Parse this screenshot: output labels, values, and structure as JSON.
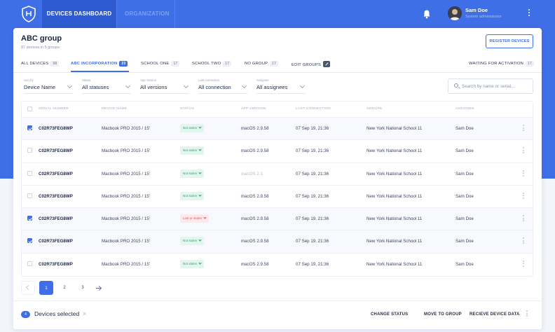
{
  "nav": {
    "items": [
      "DEVICES DASHBOARD",
      "ORGANIZATION"
    ]
  },
  "user": {
    "name": "Sam Doe",
    "role": "System administrator"
  },
  "group": {
    "title": "ABC group",
    "subtitle": "87 devices in 5 groups",
    "register_label": "REGISTER DEVICES"
  },
  "tabs": [
    {
      "label": "ALL DEVICES",
      "count": "98"
    },
    {
      "label": "ABC INCORPORATION",
      "count": "23"
    },
    {
      "label": "SCHOOL ONE",
      "count": "17"
    },
    {
      "label": "SCHOOL TWO",
      "count": "17"
    },
    {
      "label": "NO GROUP",
      "count": "17"
    },
    {
      "label": "EDIT GROUPS",
      "count": ""
    },
    {
      "label": "WAITING FOR ACTIVATION",
      "count": "17"
    }
  ],
  "filters": [
    {
      "label": "Sort by",
      "value": "Device Name"
    },
    {
      "label": "Status",
      "value": "All statuses"
    },
    {
      "label": "App Version",
      "value": "All versions"
    },
    {
      "label": "Last connection",
      "value": "All connection"
    },
    {
      "label": "Assignee",
      "value": "All assignees"
    }
  ],
  "search": {
    "placeholder": "Search by name or serial..."
  },
  "table": {
    "headers": [
      "SERIAL NUMBER",
      "DEVICE NAME",
      "STATUS",
      "APP VERSION",
      "LAST CONNECTION",
      "GROUPE",
      "ASSIGNEE"
    ],
    "rows": [
      {
        "checked": true,
        "serial": "C02R73FEG8WP",
        "device": "Macbook PRO 2015 / 15'",
        "status": "Not stolen",
        "status_kind": "ok",
        "app": "macOS 2.9.58",
        "app_dim": false,
        "last": "07 Sep 19, 21:36",
        "group": "New York National School 11",
        "assignee": "Sam Doe"
      },
      {
        "checked": false,
        "serial": "C02R73FEG8WP",
        "device": "Macbook PRO 2015 / 15'",
        "status": "Not stolen",
        "status_kind": "ok",
        "app": "macOS 2.9.58",
        "app_dim": false,
        "last": "07 Sep 19, 21:36",
        "group": "New York National School 11",
        "assignee": "Sam Doe"
      },
      {
        "checked": false,
        "serial": "C02R73FEG8WP",
        "device": "Macbook PRO 2015 / 15'",
        "status": "Not stolen",
        "status_kind": "ok",
        "app": "macOS 2.1",
        "app_dim": true,
        "last": "07 Sep 19, 21:36",
        "group": "New York National School 11",
        "assignee": "Sam Doe"
      },
      {
        "checked": false,
        "serial": "C02R73FEG8WP",
        "device": "Macbook PRO 2015 / 15'",
        "status": "Not stolen",
        "status_kind": "ok",
        "app": "macOS 2.9.58",
        "app_dim": false,
        "last": "07 Sep 19, 21:36",
        "group": "New York National School 11",
        "assignee": "Sam Doe"
      },
      {
        "checked": true,
        "serial": "C02R73FEG8WP",
        "device": "Macbook PRO 2015 / 15'",
        "status": "Lost or stolen",
        "status_kind": "bad",
        "app": "macOS 2.9.58",
        "app_dim": false,
        "last": "07 Sep 19, 21:36",
        "group": "New York National School 11",
        "assignee": "Sam Doe"
      },
      {
        "checked": true,
        "serial": "C02R73FEG8WP",
        "device": "Macbook PRO 2015 / 15'",
        "status": "Not stolen",
        "status_kind": "ok",
        "app": "macOS 2.9.58",
        "app_dim": false,
        "last": "07 Sep 19, 21:36",
        "group": "New York National School 11",
        "assignee": "Sam Doe"
      },
      {
        "checked": false,
        "serial": "C02R73FEG8WP",
        "device": "Macbook PRO 2015 / 15'",
        "status": "Not stolen",
        "status_kind": "ok",
        "app": "macOS 2.9.58",
        "app_dim": false,
        "last": "07 Sep 19, 21:36",
        "group": "New York National School 11",
        "assignee": "Sam Doe"
      }
    ]
  },
  "pagination": {
    "pages": [
      "1",
      "2",
      "3"
    ],
    "current": "1"
  },
  "bottom_bar": {
    "selected_count": "4",
    "selected_text": "Devices selected",
    "close_glyph": "×",
    "actions": [
      "CHANGE STATUS",
      "MOVE TO GROUP",
      "RECIEVE DEVICE DATA"
    ]
  },
  "colors": {
    "accent": "#3f6fe6",
    "ok": "#2f9f72",
    "danger": "#e0525f"
  },
  "icons": [
    "shield-logo-icon",
    "bell-icon",
    "kebab-icon",
    "search-icon",
    "edit-icon",
    "chevron-down-icon",
    "arrow-left-icon",
    "arrow-right-icon",
    "close-icon"
  ]
}
